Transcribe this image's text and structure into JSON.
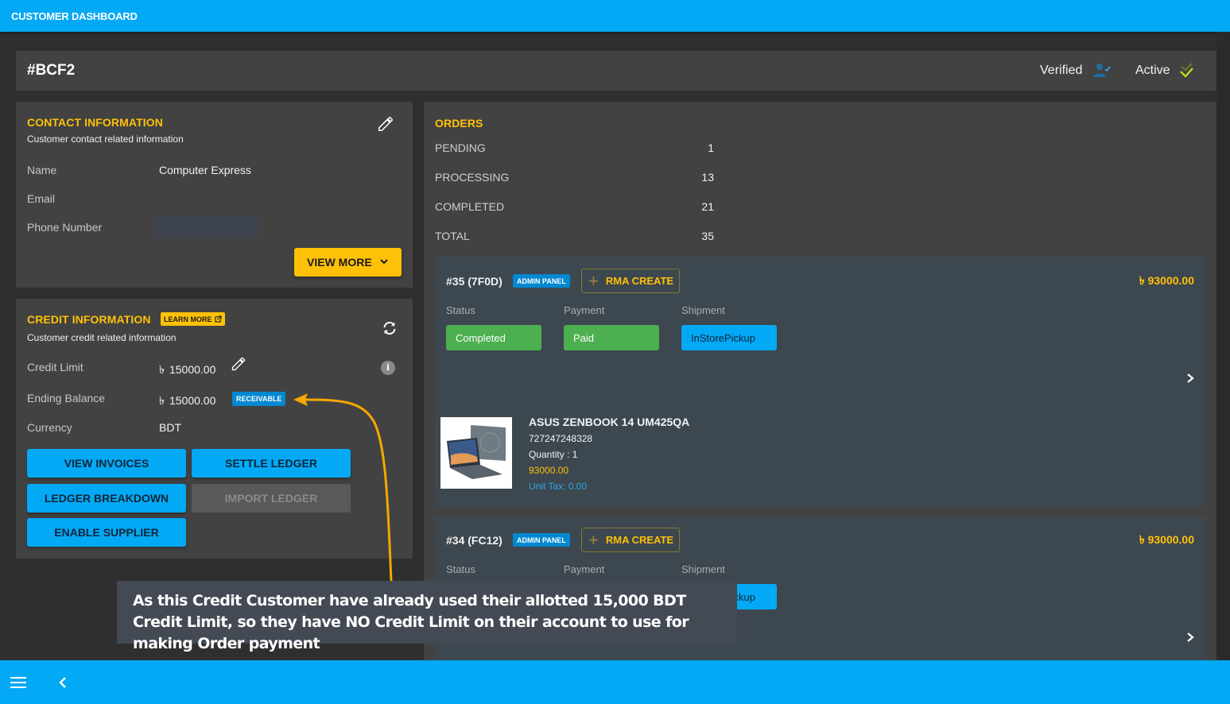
{
  "app": {
    "title": "CUSTOMER DASHBOARD"
  },
  "customer": {
    "id": "#BCF2",
    "verified_label": "Verified",
    "active_label": "Active"
  },
  "contact": {
    "title": "CONTACT INFORMATION",
    "subtitle": "Customer contact related information",
    "fields": [
      {
        "label": "Name",
        "value": "Computer Express"
      },
      {
        "label": "Email",
        "value": ""
      },
      {
        "label": "Phone Number",
        "value": ""
      }
    ],
    "view_more_label": "VIEW MORE"
  },
  "credit": {
    "title": "CREDIT INFORMATION",
    "learn_more_label": "LEARN MORE",
    "subtitle": "Customer credit related information",
    "currency_symbol": "৳",
    "fields": [
      {
        "label": "Credit Limit",
        "value": "15000.00"
      },
      {
        "label": "Ending Balance",
        "value": "15000.00",
        "badge": "RECEIVABLE"
      },
      {
        "label": "Currency",
        "value": "BDT"
      }
    ],
    "buttons": {
      "view_invoices": "VIEW INVOICES",
      "settle_ledger": "SETTLE LEDGER",
      "ledger_breakdown": "LEDGER BREAKDOWN",
      "import_ledger": "IMPORT LEDGER",
      "enable_supplier": "ENABLE SUPPLIER"
    }
  },
  "orders": {
    "title": "ORDERS",
    "stats": [
      {
        "label": "PENDING",
        "value": "1"
      },
      {
        "label": "PROCESSING",
        "value": "13"
      },
      {
        "label": "COMPLETED",
        "value": "21"
      },
      {
        "label": "TOTAL",
        "value": "35"
      }
    ],
    "column_labels": {
      "status": "Status",
      "payment": "Payment",
      "shipment": "Shipment"
    },
    "list": [
      {
        "id": "#35 (7F0D)",
        "badge": "ADMIN PANEL",
        "rma_label": "RMA CREATE",
        "amount": "৳  93000.00",
        "status": "Completed",
        "payment": "Paid",
        "shipment": "InStorePickup",
        "product": {
          "name": "ASUS ZENBOOK 14 UM425QA",
          "sku": "727247248328",
          "quantity": "Quantity : 1",
          "price": "93000.00",
          "unit_tax": "Unit Tax: 0.00"
        }
      },
      {
        "id": "#34 (FC12)",
        "badge": "ADMIN PANEL",
        "rma_label": "RMA CREATE",
        "amount": "৳  93000.00",
        "status": "",
        "payment": "",
        "shipment": "InStorePickup"
      }
    ]
  },
  "annotation": {
    "text": "As this Credit Customer have already used their allotted 15,000 BDT Credit Limit, so they have NO Credit Limit on their account to use for making Order payment",
    "color": "#f5a800"
  },
  "colors": {
    "primary": "#03a9f4",
    "accent": "#ffc107",
    "success": "#4caf50",
    "badge_blue": "#0288d1"
  }
}
